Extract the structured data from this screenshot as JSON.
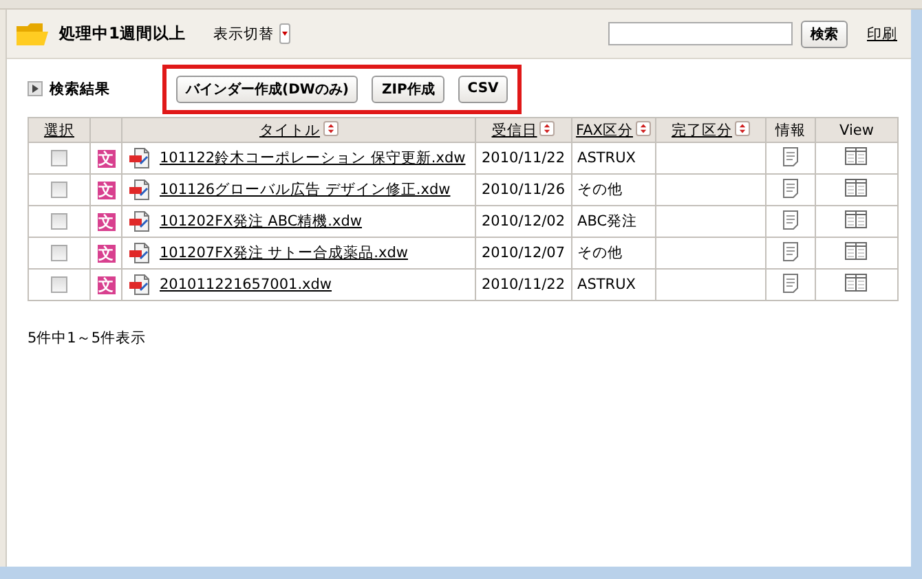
{
  "header": {
    "title": "処理中1週間以上",
    "view_toggle": "表示切替",
    "search_button": "検索",
    "print_link": "印刷"
  },
  "results": {
    "label": "検索結果"
  },
  "actions": {
    "highlighted": true,
    "buttons": [
      "バインダー作成(DWのみ)",
      "ZIP作成",
      "CSV"
    ]
  },
  "table": {
    "columns": [
      {
        "kind": "check",
        "label": "選択",
        "link": true,
        "sortable": false
      },
      {
        "kind": "badge"
      },
      {
        "kind": "title",
        "label": "タイトル",
        "link": true,
        "sortable": true
      },
      {
        "kind": "date",
        "label": "受信日",
        "link": true,
        "sortable": true
      },
      {
        "kind": "fax",
        "label": "FAX区分",
        "link": true,
        "sortable": true
      },
      {
        "kind": "done",
        "label": "完了区分",
        "link": true,
        "sortable": true
      },
      {
        "kind": "info",
        "label": "情報",
        "link": false,
        "sortable": false
      },
      {
        "kind": "view",
        "label": "View",
        "link": false,
        "sortable": false
      }
    ],
    "rows": [
      {
        "checked": false,
        "badge": "文",
        "title": "101122鈴木コーポレーション 保守更新.xdw",
        "date": "2010/11/22",
        "fax": "ASTRUX"
      },
      {
        "checked": false,
        "badge": "文",
        "title": "101126グローバル広告 デザイン修正.xdw",
        "date": "2010/11/26",
        "fax": "その他"
      },
      {
        "checked": false,
        "badge": "文",
        "title": "101202FX発注 ABC精機.xdw",
        "date": "2010/12/02",
        "fax": "ABC発注"
      },
      {
        "checked": false,
        "badge": "文",
        "title": "101207FX発注 サトー合成薬品.xdw",
        "date": "2010/12/07",
        "fax": "その他"
      },
      {
        "checked": false,
        "badge": "文",
        "title": "201011221657001.xdw",
        "date": "2010/11/22",
        "fax": "ASTRUX"
      }
    ]
  },
  "summary": "5件中1～5件表示"
}
